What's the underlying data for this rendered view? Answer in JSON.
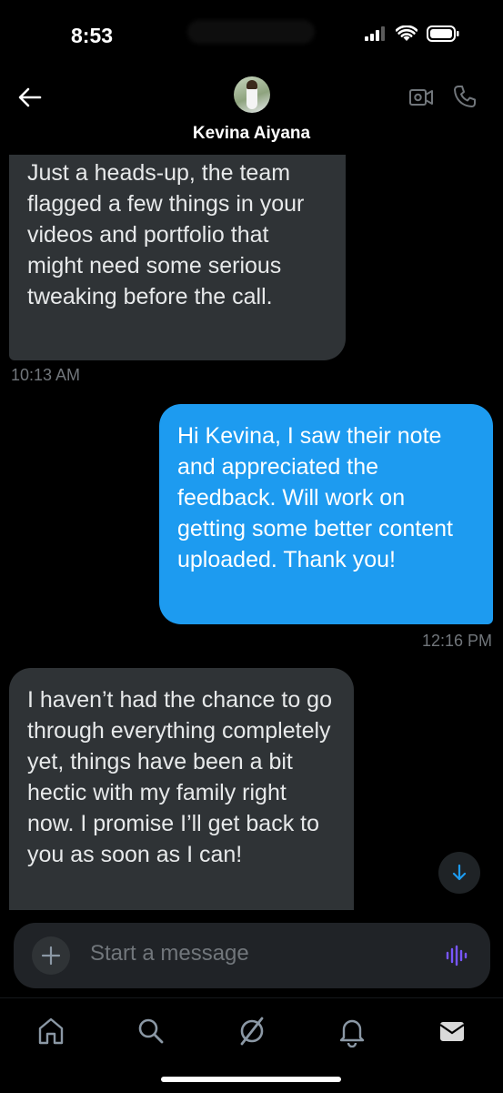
{
  "status_bar": {
    "time": "8:53"
  },
  "header": {
    "contact_name": "Kevina Aiyana"
  },
  "messages": [
    {
      "direction": "incoming",
      "text": "Just a heads-up, the team flagged a few things in your videos and portfolio that might need some serious tweaking before the call.",
      "timestamp": "10:13 AM"
    },
    {
      "direction": "outgoing",
      "text": "Hi Kevina, I saw their note and appreciated the feedback. Will work on getting some better content uploaded. Thank you!",
      "timestamp": "12:16 PM"
    },
    {
      "direction": "incoming",
      "text": "I haven’t had the chance to go through everything completely yet, things have been a bit hectic with my family right now. I promise I’ll get back to you as soon as I can!"
    }
  ],
  "composer": {
    "placeholder": "Start a message"
  },
  "tabs": [
    "home",
    "search",
    "grok",
    "notifications",
    "messages"
  ],
  "colors": {
    "outgoing_bubble": "#1d9bf0",
    "incoming_bubble": "#2f3336",
    "voice_accent": "#7856ff"
  }
}
